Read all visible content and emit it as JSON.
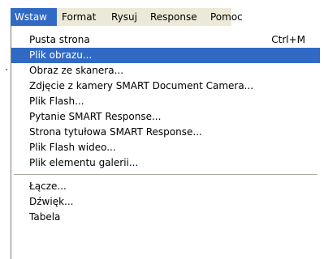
{
  "menubar": {
    "titles": [
      "Wstaw",
      "Format",
      "Rysuj",
      "Response",
      "Pomoc"
    ]
  },
  "dropdown": {
    "items": [
      {
        "label": "Pusta strona",
        "shortcut": "Ctrl+M"
      },
      {
        "label": "Plik obrazu...",
        "shortcut": ""
      },
      {
        "label": "Obraz ze skanera...",
        "shortcut": ""
      },
      {
        "label": "Zdjęcie z kamery SMART Document Camera...",
        "shortcut": ""
      },
      {
        "label": "Plik Flash...",
        "shortcut": ""
      },
      {
        "label": "Pytanie SMART Response...",
        "shortcut": ""
      },
      {
        "label": "Strona tytułowa SMART Response...",
        "shortcut": ""
      },
      {
        "label": "Plik Flash wideo...",
        "shortcut": ""
      },
      {
        "label": "Plik elementu galerii...",
        "shortcut": ""
      },
      {
        "label": "Łącze...",
        "shortcut": ""
      },
      {
        "label": "Dźwięk...",
        "shortcut": ""
      },
      {
        "label": "Tabela",
        "shortcut": ""
      }
    ]
  },
  "colors": {
    "highlight": "#316ac5",
    "highlight_text": "#ffffff",
    "menubar_bg": "#ece9d8",
    "menu_bg": "#ffffff"
  }
}
